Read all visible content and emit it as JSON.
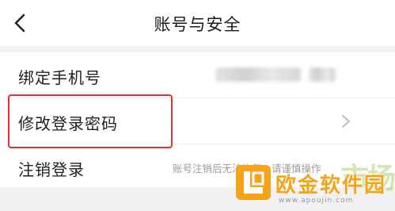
{
  "header": {
    "title": "账号与安全"
  },
  "rows": [
    {
      "label": "绑定手机号"
    },
    {
      "label": "修改登录密码"
    },
    {
      "label": "注销登录",
      "hint": "账号注销后无法恢复，请谨慎操作"
    }
  ],
  "watermark": {
    "faint": "市场",
    "text": "欧金软件园",
    "url": "www.apoujin.com"
  },
  "colors": {
    "highlight": "#e0322e",
    "watermark": "#f5a41a"
  }
}
